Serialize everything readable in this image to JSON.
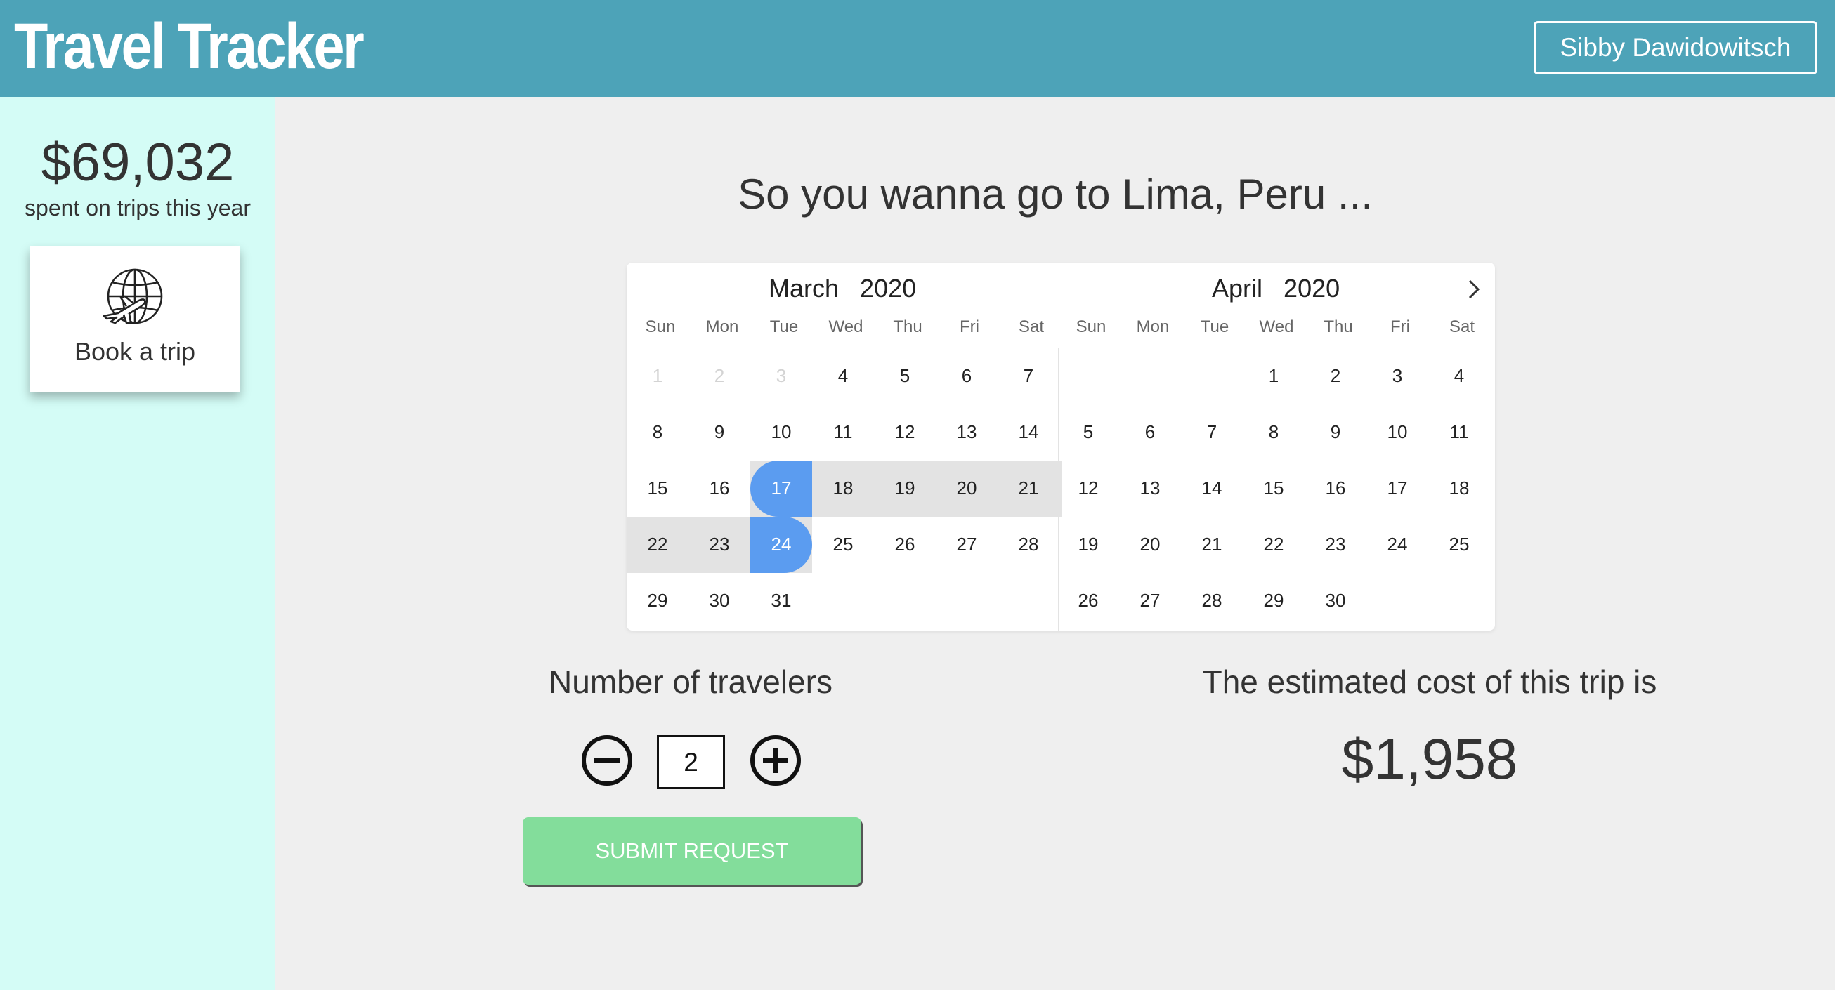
{
  "header": {
    "app_title": "Travel Tracker",
    "user_name": "Sibby Dawidowitsch",
    "background_color": "#4da3b8"
  },
  "sidebar": {
    "spent_amount": "$69,032",
    "spent_caption": "spent on trips this year",
    "book_trip_label": "Book a trip",
    "book_trip_icon": "globe-airplane-icon",
    "background_color": "#d4fcf6"
  },
  "main": {
    "destination_title": "So you wanna go to Lima, Peru ...",
    "calendar": {
      "weekdays": [
        "Sun",
        "Mon",
        "Tue",
        "Wed",
        "Thu",
        "Fri",
        "Sat"
      ],
      "next_icon": "chevron-right-icon",
      "selected_start": "March 17, 2020",
      "selected_end": "March 24, 2020",
      "selection_color": "#5b9cf0",
      "range_color": "#e3e3e3",
      "months": [
        {
          "month": "March",
          "year": "2020",
          "first_weekday": 0,
          "days_in_month": 31,
          "disabled_days": [
            1,
            2,
            3
          ],
          "range_start": 17,
          "range_end": 24
        },
        {
          "month": "April",
          "year": "2020",
          "first_weekday": 3,
          "days_in_month": 30,
          "disabled_days": [],
          "range_start": null,
          "range_end": null
        }
      ]
    },
    "travelers": {
      "label": "Number of travelers",
      "count": "2",
      "decrement_icon": "minus-circle-icon",
      "increment_icon": "plus-circle-icon"
    },
    "submit_label": "SUBMIT REQUEST",
    "submit_color": "#83dd9b",
    "cost": {
      "label": "The estimated cost of this trip is",
      "value": "$1,958"
    }
  }
}
